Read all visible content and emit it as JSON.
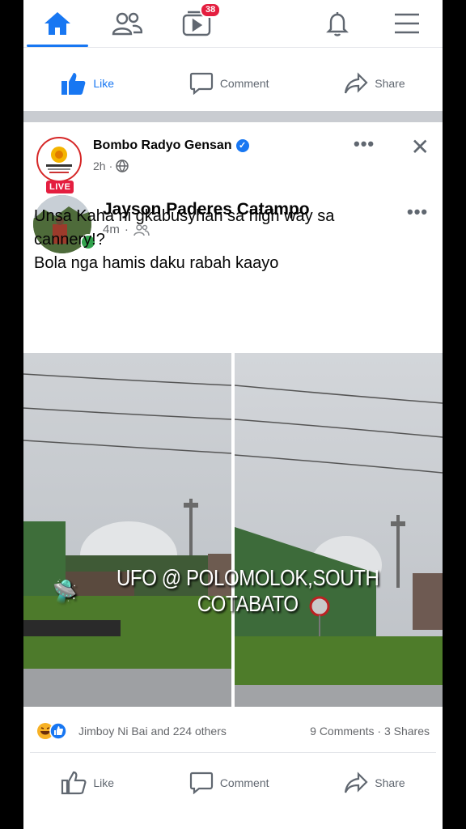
{
  "nav": {
    "items": [
      {
        "name": "home-icon",
        "active": true
      },
      {
        "name": "friends-icon"
      },
      {
        "name": "watch-icon",
        "badge": "38"
      },
      {
        "name": "notifications-icon"
      },
      {
        "name": "menu-icon"
      }
    ]
  },
  "prev_actions": {
    "like": "Like",
    "comment": "Comment",
    "share": "Share"
  },
  "page": {
    "name": "Bombo Radyo Gensan",
    "time": "2h",
    "live": "LIVE"
  },
  "shared_post": {
    "author": "Jayson Paderes Catampo",
    "time": "4m",
    "text_lines": [
      "Unsa Kaha ni gkabusyhan sa high way sa",
      "cannery!?",
      "Bola nga hamis daku rabah kaayo"
    ]
  },
  "overlay_caption": "UFO @ POLOMOLOK,SOUTH COTABATO",
  "reactions": {
    "text": "Jimboy Ni Bai and 224 others",
    "comments": "9 Comments",
    "shares": "3 Shares"
  },
  "actions": {
    "like": "Like",
    "comment": "Comment",
    "share": "Share"
  },
  "colors": {
    "accent": "#1877f2",
    "badge": "#e41e3f",
    "online": "#31a24c"
  }
}
